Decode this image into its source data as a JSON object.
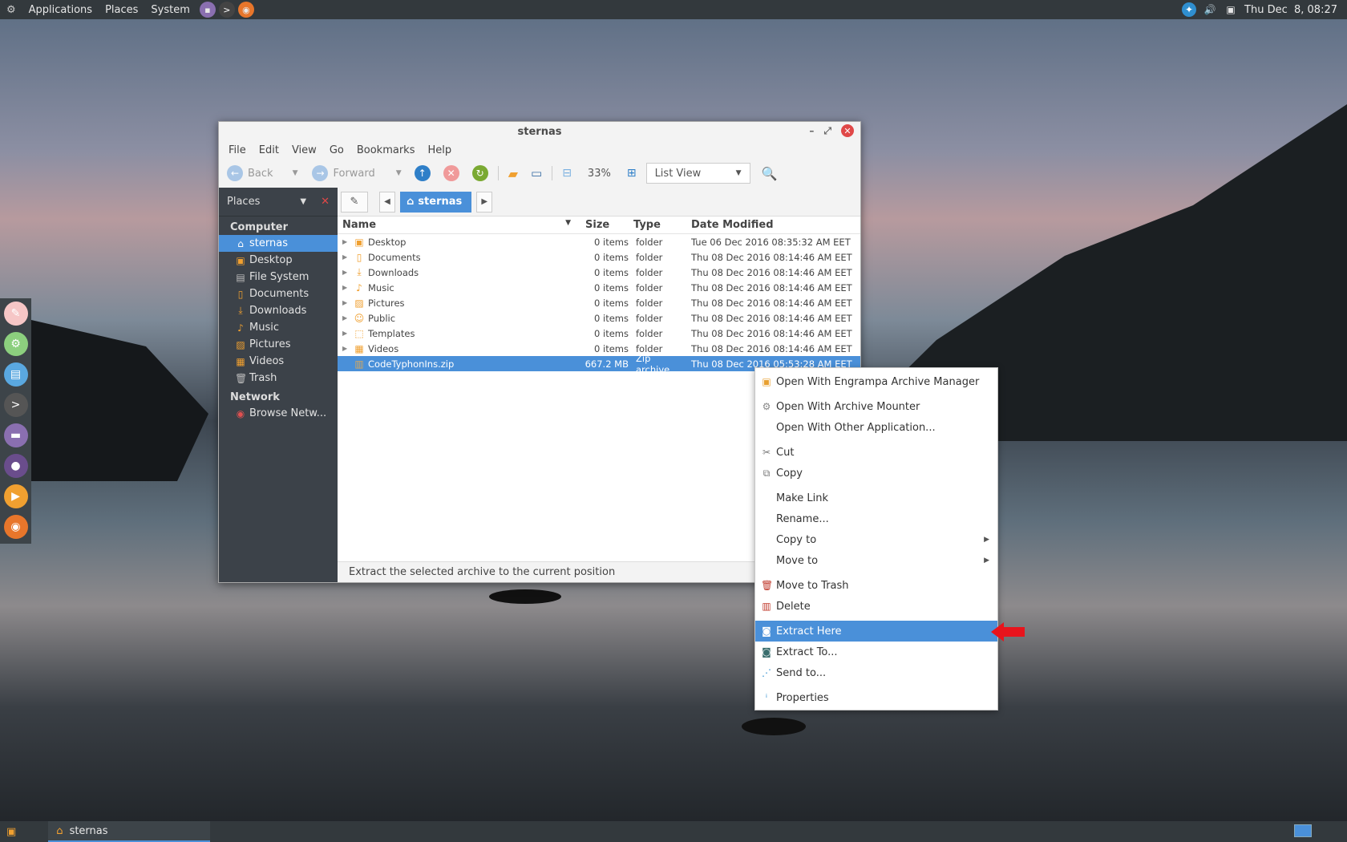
{
  "top_panel": {
    "menus": [
      "Applications",
      "Places",
      "System"
    ],
    "clock": "Thu Dec  8, 08:27"
  },
  "window": {
    "title": "sternas",
    "menubar": [
      "File",
      "Edit",
      "View",
      "Go",
      "Bookmarks",
      "Help"
    ],
    "toolbar": {
      "back": "Back",
      "forward": "Forward",
      "zoom": "33%",
      "view_mode": "List View"
    },
    "sidebar": {
      "header": "Places",
      "computer_label": "Computer",
      "network_label": "Network",
      "items": [
        "sternas",
        "Desktop",
        "File System",
        "Documents",
        "Downloads",
        "Music",
        "Pictures",
        "Videos",
        "Trash"
      ],
      "network_items": [
        "Browse Netw..."
      ]
    },
    "pathbar": {
      "crumb": "sternas"
    },
    "columns": {
      "name": "Name",
      "size": "Size",
      "type": "Type",
      "date": "Date Modified"
    },
    "files": [
      {
        "name": "Desktop",
        "size": "0 items",
        "type": "folder",
        "date": "Tue 06 Dec 2016 08:35:32 AM EET"
      },
      {
        "name": "Documents",
        "size": "0 items",
        "type": "folder",
        "date": "Thu 08 Dec 2016 08:14:46 AM EET"
      },
      {
        "name": "Downloads",
        "size": "0 items",
        "type": "folder",
        "date": "Thu 08 Dec 2016 08:14:46 AM EET"
      },
      {
        "name": "Music",
        "size": "0 items",
        "type": "folder",
        "date": "Thu 08 Dec 2016 08:14:46 AM EET"
      },
      {
        "name": "Pictures",
        "size": "0 items",
        "type": "folder",
        "date": "Thu 08 Dec 2016 08:14:46 AM EET"
      },
      {
        "name": "Public",
        "size": "0 items",
        "type": "folder",
        "date": "Thu 08 Dec 2016 08:14:46 AM EET"
      },
      {
        "name": "Templates",
        "size": "0 items",
        "type": "folder",
        "date": "Thu 08 Dec 2016 08:14:46 AM EET"
      },
      {
        "name": "Videos",
        "size": "0 items",
        "type": "folder",
        "date": "Thu 08 Dec 2016 08:14:46 AM EET"
      },
      {
        "name": "CodeTyphonIns.zip",
        "size": "667.2 MB",
        "type": "Zip archive",
        "date": "Thu 08 Dec 2016 05:53:28 AM EET"
      }
    ],
    "status": "Extract the selected archive to the current position"
  },
  "context_menu": {
    "open_engrampa": "Open With Engrampa Archive Manager",
    "open_mounter": "Open With Archive Mounter",
    "open_other": "Open With Other Application...",
    "cut": "Cut",
    "copy": "Copy",
    "make_link": "Make Link",
    "rename": "Rename...",
    "copy_to": "Copy to",
    "move_to": "Move to",
    "move_trash": "Move to Trash",
    "delete": "Delete",
    "extract_here": "Extract Here",
    "extract_to": "Extract To...",
    "send_to": "Send to...",
    "properties": "Properties"
  },
  "taskbar": {
    "task": "sternas"
  },
  "colors": {
    "accent": "#4a90d9",
    "close": "#e04848",
    "folder": "#f0a030",
    "arrow": "#e8141c"
  }
}
